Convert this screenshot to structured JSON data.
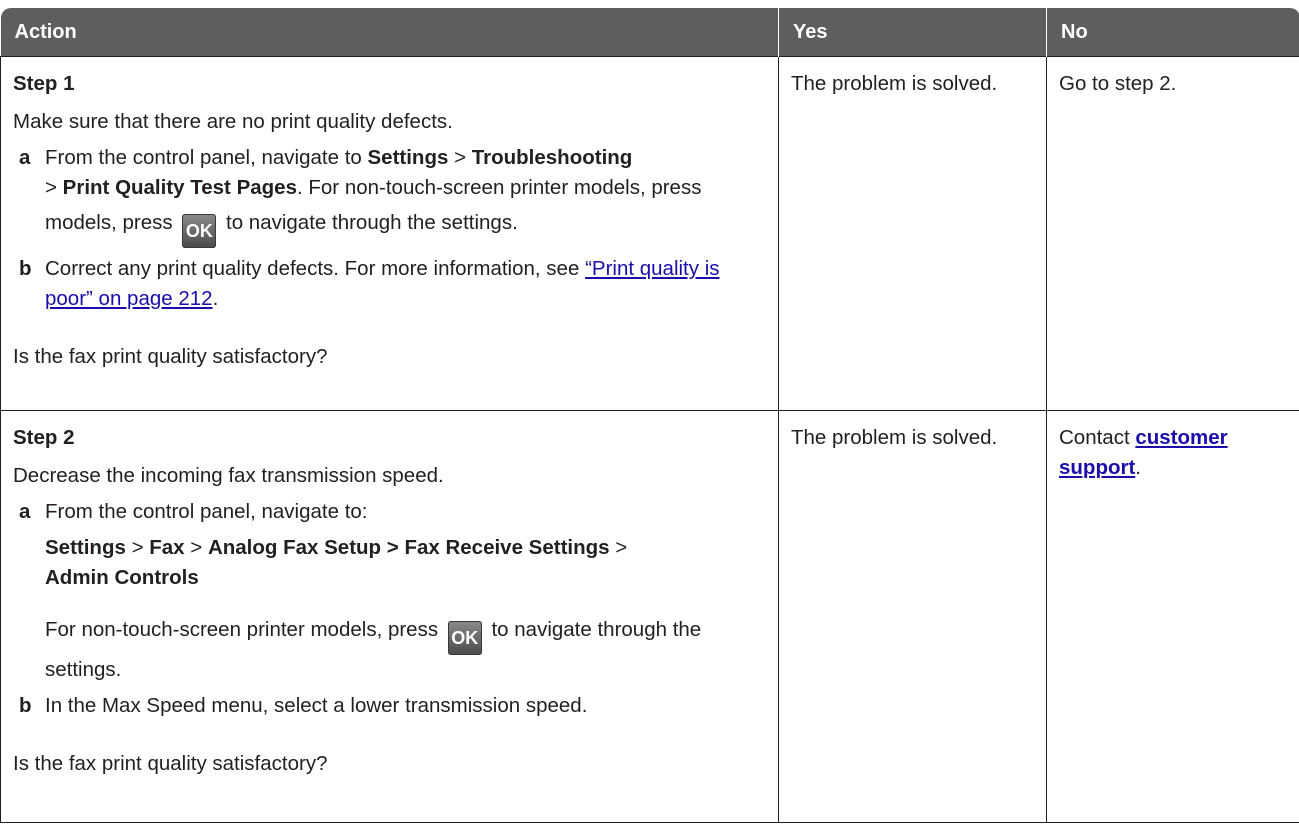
{
  "header": {
    "action": "Action",
    "yes": "Yes",
    "no": "No"
  },
  "step1": {
    "title": "Step 1",
    "intro": "Make sure that there are no print quality defects.",
    "a": {
      "letter": "a",
      "t1": "From the control panel, navigate to ",
      "settings": "Settings",
      "gt1": " > ",
      "troubleshooting": "Troubleshooting",
      "gt2": " > ",
      "pqtp": "Print Quality Test Pages",
      "t2": ". For non-touch-screen printer models, press ",
      "ok": "OK",
      "t3": " to navigate through the settings."
    },
    "b": {
      "letter": "b",
      "t1": "Correct any print quality defects. For more information, see ",
      "link": "“Print quality is poor” on page 212",
      "t2": "."
    },
    "question": "Is the fax print quality satisfactory?",
    "yes": "The problem is solved.",
    "no": "Go to step 2."
  },
  "step2": {
    "title": "Step 2",
    "intro": "Decrease the incoming fax transmission speed.",
    "a": {
      "letter": "a",
      "t1": "From the control panel, navigate to:",
      "settings": "Settings",
      "gt1": " > ",
      "fax": "Fax",
      "gt2": " > ",
      "analog": "Analog Fax Setup > Fax Receive Settings",
      "gt3": " > ",
      "admin": "Admin Controls",
      "t2": "For non-touch-screen printer models, press ",
      "ok": "OK",
      "t3": " to navigate through the settings."
    },
    "b": {
      "letter": "b",
      "t1": "In the Max Speed menu, select a lower transmission speed."
    },
    "question": "Is the fax print quality satisfactory?",
    "yes": "The problem is solved.",
    "no_prefix": "Contact ",
    "no_link": "customer support",
    "no_suffix": "."
  }
}
